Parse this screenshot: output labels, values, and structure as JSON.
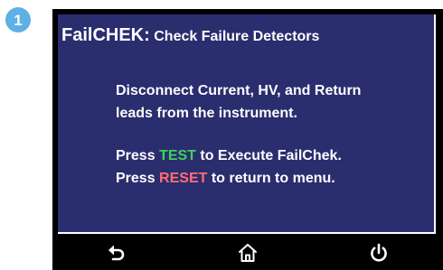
{
  "step": {
    "number": "1"
  },
  "screen": {
    "title_bold": "FailCHEK:",
    "title_rest": " Check Failure Detectors",
    "instruction_line1": "Disconnect Current, HV, and Return",
    "instruction_line2": "leads from the instrument.",
    "line3_prefix": "Press ",
    "line3_key": "TEST",
    "line3_suffix": " to Execute FailChek.",
    "line4_prefix": "Press ",
    "line4_key": "RESET",
    "line4_suffix": " to return to menu."
  },
  "bottom_bar": {
    "icons": [
      "back-icon",
      "home-icon",
      "power-icon"
    ]
  },
  "colors": {
    "screen_bg": "#2a2d6e",
    "test_green": "#3fd35b",
    "reset_red": "#ff6f6f",
    "badge_blue": "#5eb0e5"
  }
}
